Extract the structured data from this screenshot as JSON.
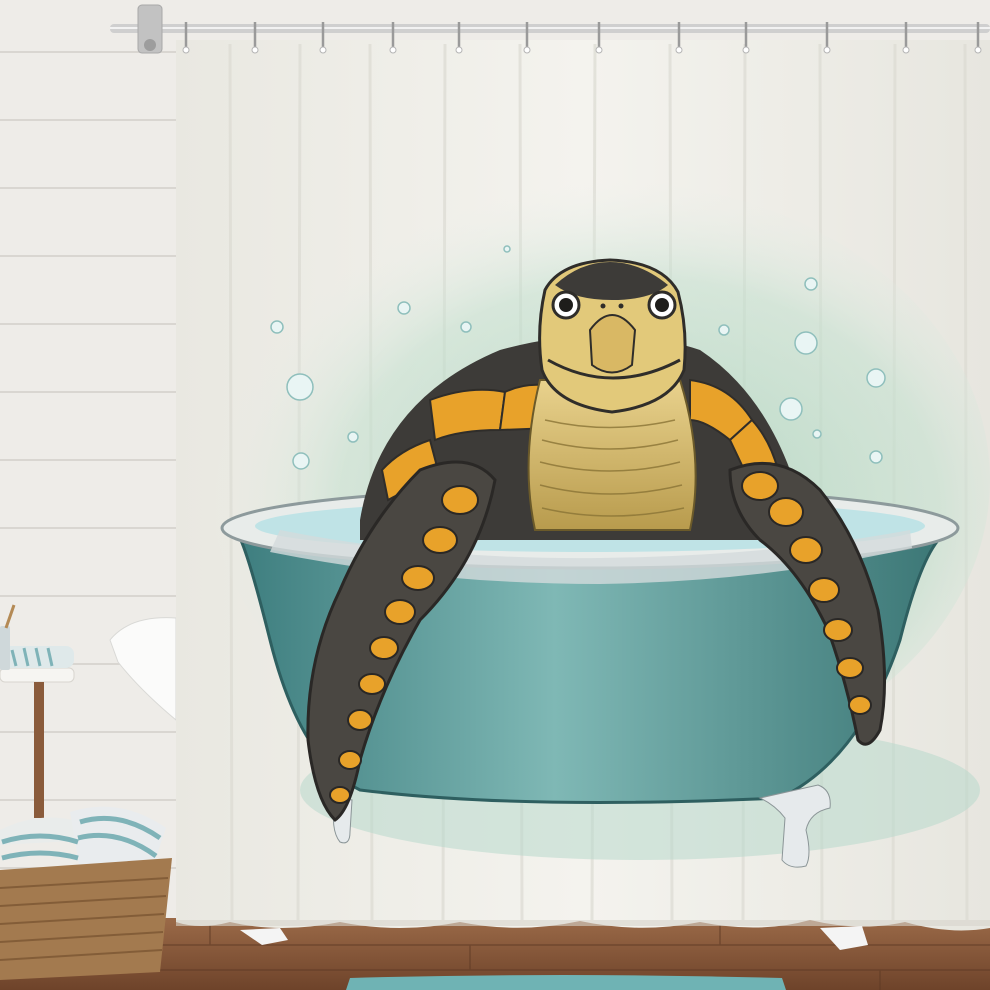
{
  "image": {
    "subject": "turtle-in-bathtub-shower-curtain",
    "colors": {
      "wall": "#eeece8",
      "wall_plank_line": "#d9d6d1",
      "floor": "#8b5a3c",
      "curtain": "#f1f0ea",
      "watercolor": "#b9d9c6",
      "tub": "#5f9c9a",
      "tub_rim": "#e8ecea",
      "water": "#bfe3e6",
      "turtle_skin": "#e2c97a",
      "turtle_shell_dark": "#3d3b38",
      "turtle_shell_orange": "#e8a22a",
      "rug": "#6fb3b4",
      "basket": "#a37a4f",
      "towel_stripe": "#7fb3b8",
      "rod": "#c9c9c9"
    }
  }
}
